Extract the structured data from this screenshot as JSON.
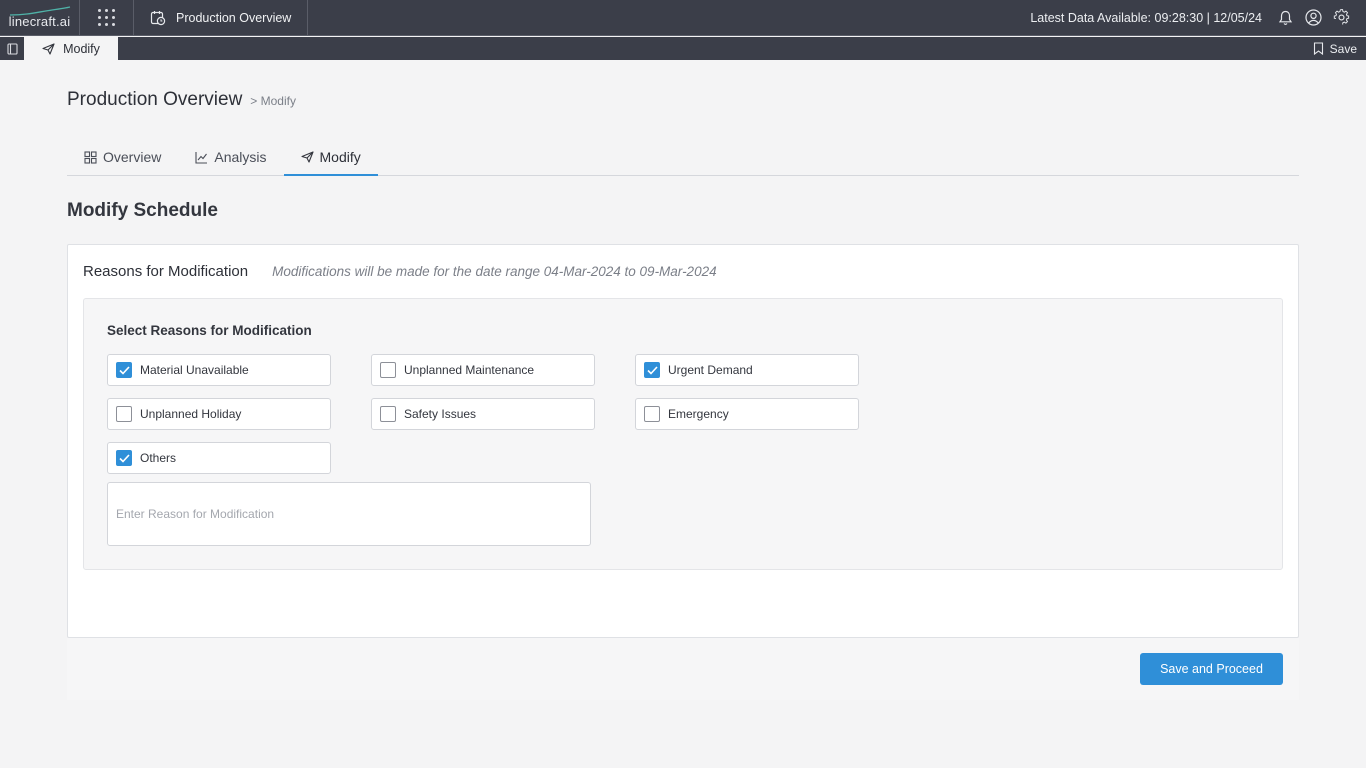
{
  "app": {
    "logo_text": "linecraft.ai",
    "title": "Production Overview",
    "latest_data": "Latest Data Available: 09:28:30 | 12/05/24"
  },
  "tabbar": {
    "page_tab_label": "Modify",
    "save_label": "Save"
  },
  "page": {
    "title": "Production Overview",
    "breadcrumb": "> Modify"
  },
  "tabs": [
    {
      "label": "Overview",
      "icon": "grid-icon",
      "active": false
    },
    {
      "label": "Analysis",
      "icon": "line-chart-icon",
      "active": false
    },
    {
      "label": "Modify",
      "icon": "send-icon",
      "active": true
    }
  ],
  "section_title": "Modify Schedule",
  "card": {
    "title": "Reasons for Modification",
    "note": "Modifications will be made for the date range 04-Mar-2024 to 09-Mar-2024",
    "select_title": "Select Reasons for Modification",
    "reasons": [
      {
        "label": "Material Unavailable",
        "checked": true
      },
      {
        "label": "Unplanned Maintenance",
        "checked": false
      },
      {
        "label": "Urgent Demand",
        "checked": true
      },
      {
        "label": "Unplanned Holiday",
        "checked": false
      },
      {
        "label": "Safety Issues",
        "checked": false
      },
      {
        "label": "Emergency",
        "checked": false
      },
      {
        "label": "Others",
        "checked": true
      }
    ],
    "reason_placeholder": "Enter Reason for Modification",
    "reason_value": ""
  },
  "actions": {
    "proceed_label": "Save and Proceed"
  },
  "colors": {
    "accent": "#2f8fd8",
    "topbar": "#3b3e49",
    "background": "#f4f4f5"
  }
}
